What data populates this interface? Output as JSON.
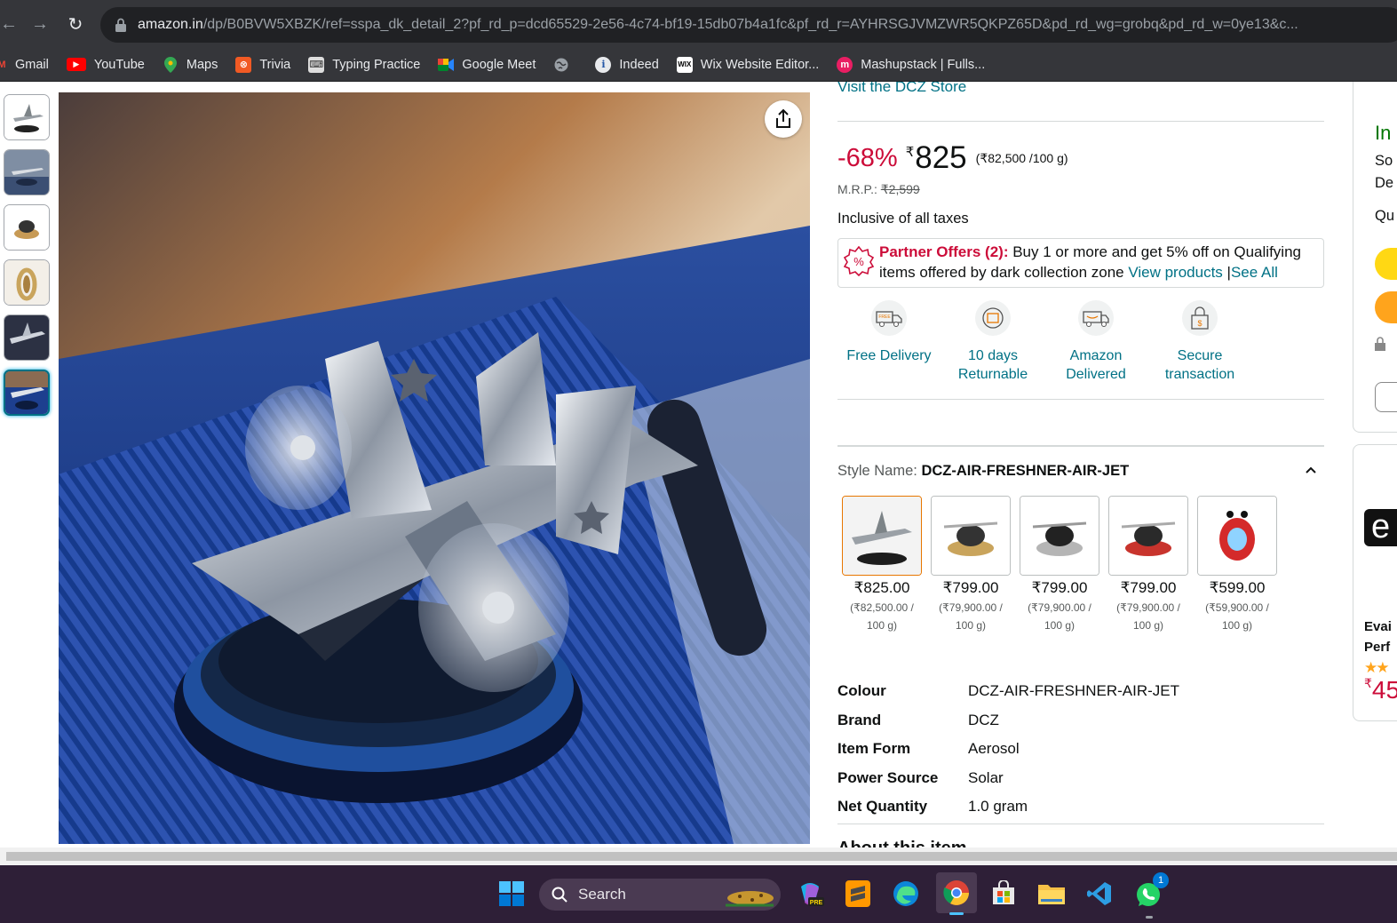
{
  "browser": {
    "url_host": "amazon.in",
    "url_path": "/dp/B0BVW5XBZK/ref=sspa_dk_detail_2?pf_rd_p=dcd65529-2e56-4c74-bf19-15db07b4a1fc&pf_rd_r=AYHRSGJVMZWR5QKPZ65D&pd_rd_wg=grobq&pd_rd_w=0ye13&c...",
    "bookmarks": [
      "Gmail",
      "YouTube",
      "Maps",
      "Trivia",
      "Typing Practice",
      "Google Meet",
      "",
      "Indeed",
      "Wix Website Editor...",
      "Mashupstack | Fulls..."
    ]
  },
  "product": {
    "store_link": "Visit the DCZ Store",
    "discount": "-68%",
    "currency": "₹",
    "price": "825",
    "unit_price": "(₹82,500 /100 g)",
    "mrp_label": "M.R.P.:",
    "mrp": "₹2,599",
    "taxes": "Inclusive of all taxes",
    "offer": {
      "title": "Partner Offers (2):",
      "text1": " Buy 1 or more and get 5% off on Qualifying",
      "text2": "items offered by dark collection zone ",
      "view": "View products",
      "sep": " |",
      "see_all": "See All"
    },
    "features": [
      {
        "line1": "Free Delivery",
        "line2": ""
      },
      {
        "line1": "10 days",
        "line2": "Returnable"
      },
      {
        "line1": "Amazon",
        "line2": "Delivered"
      },
      {
        "line1": "Secure",
        "line2": "transaction"
      }
    ],
    "style_label": "Style Name: ",
    "style_value": "DCZ-AIR-FRESHNER-AIR-JET",
    "variants": [
      {
        "price": "₹825.00",
        "unit1": "(₹82,500.00 /",
        "unit2": "100 g)"
      },
      {
        "price": "₹799.00",
        "unit1": "(₹79,900.00 /",
        "unit2": "100 g)"
      },
      {
        "price": "₹799.00",
        "unit1": "(₹79,900.00 /",
        "unit2": "100 g)"
      },
      {
        "price": "₹799.00",
        "unit1": "(₹79,900.00 /",
        "unit2": "100 g)"
      },
      {
        "price": "₹599.00",
        "unit1": "(₹59,900.00 /",
        "unit2": "100 g)"
      }
    ],
    "specs": [
      {
        "key": "Colour",
        "value": "DCZ-AIR-FRESHNER-AIR-JET"
      },
      {
        "key": "Brand",
        "value": "DCZ"
      },
      {
        "key": "Item Form",
        "value": "Aerosol"
      },
      {
        "key": "Power Source",
        "value": "Solar"
      },
      {
        "key": "Net Quantity",
        "value": "1.0 gram"
      }
    ],
    "about": "About this item"
  },
  "buybox": {
    "in_stock": "In",
    "line1": "So",
    "line2": "De",
    "qty": "Qu"
  },
  "ad": {
    "brand_letter": "e",
    "title1": "Evai",
    "title2": "Perf",
    "price": "45"
  },
  "taskbar": {
    "search": "Search",
    "whatsapp_badge": "1"
  },
  "colors": {
    "link": "#007185",
    "deal_red": "#cc0c39",
    "in_stock": "#007600",
    "taskbar_bg": "#2e1f37",
    "chrome_bg": "#35363a"
  }
}
